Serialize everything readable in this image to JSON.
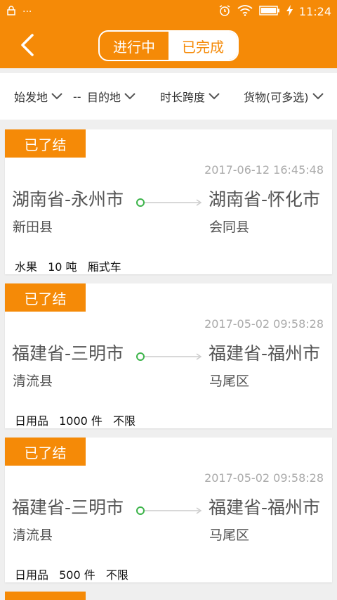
{
  "statusbar": {
    "time": "11:24",
    "dots": "···"
  },
  "navbar": {
    "tabs": [
      {
        "label": "进行中"
      },
      {
        "label": "已完成"
      }
    ]
  },
  "filters": [
    {
      "label": "始发地"
    },
    {
      "label": "目的地"
    },
    {
      "label": "时长跨度"
    },
    {
      "label": "货物(可多选)"
    }
  ],
  "filter_separator": "--",
  "orders": [
    {
      "status": "已了结",
      "time": "2017-06-12 16:45:48",
      "origin_city": "湖南省-永州市",
      "origin_county": "新田县",
      "dest_city": "湖南省-怀化市",
      "dest_county": "会同县",
      "cargo": "水果",
      "quantity": "10 吨",
      "vehicle": "厢式车"
    },
    {
      "status": "已了结",
      "time": "2017-05-02 09:58:28",
      "origin_city": "福建省-三明市",
      "origin_county": "清流县",
      "dest_city": "福建省-福州市",
      "dest_county": "马尾区",
      "cargo": "日用品",
      "quantity": "1000 件",
      "vehicle": "不限"
    },
    {
      "status": "已了结",
      "time": "2017-05-02 09:58:28",
      "origin_city": "福建省-三明市",
      "origin_county": "清流县",
      "dest_city": "福建省-福州市",
      "dest_county": "马尾区",
      "cargo": "日用品",
      "quantity": "500 件",
      "vehicle": "不限"
    }
  ],
  "colors": {
    "accent": "#f58a07",
    "route_dot": "#3cb44a"
  }
}
